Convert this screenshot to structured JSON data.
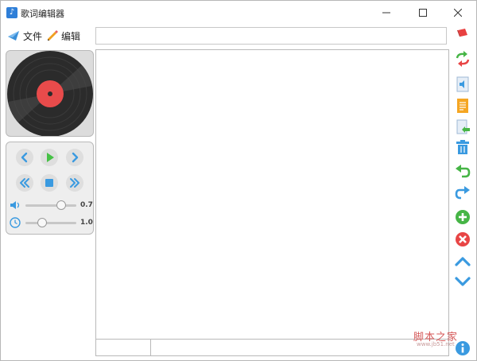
{
  "window": {
    "title": "歌词编辑器",
    "app_icon": "music-note-icon"
  },
  "menu": {
    "file_label": "文件",
    "edit_label": "编辑"
  },
  "lyric_input": {
    "value": "",
    "placeholder": ""
  },
  "player": {
    "volume": "0.7",
    "volume_fraction": 0.7,
    "speed": "1.0",
    "speed_fraction": 0.33
  },
  "status": {
    "cell1": "",
    "cell2": ""
  },
  "colors": {
    "accent_blue": "#3a9ae0",
    "play_green": "#46c146",
    "disc_red": "#e84b4b",
    "delete_red": "#e84545"
  },
  "toolbar_icons": [
    "swap-arrows-icon",
    "audio-file-icon",
    "document-icon",
    "import-icon",
    "trash-icon",
    "undo-icon",
    "redo-icon",
    "add-icon",
    "remove-icon",
    "move-up-icon",
    "move-down-icon",
    "info-icon"
  ],
  "watermark": {
    "text": "脚本之家",
    "sub": "www.jb51.net"
  }
}
